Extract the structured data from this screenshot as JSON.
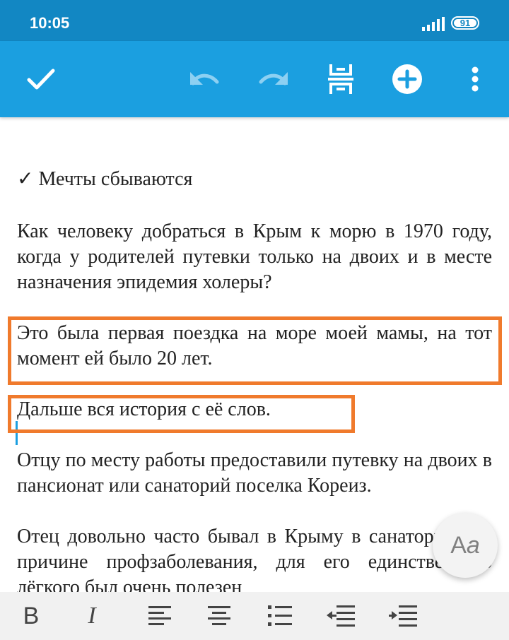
{
  "status_bar": {
    "time": "10:05",
    "battery": "91"
  },
  "toolbar": {
    "icons": [
      "check-icon",
      "undo-icon",
      "redo-icon",
      "page-layout-icon",
      "add-circle-icon",
      "more-vert-icon"
    ],
    "color": "#1b9fe0"
  },
  "document": {
    "title": "✓ Мечты сбываются",
    "paragraphs": [
      "Как человеку добраться в Крым к морю в 1970 году, когда у родителей путевки только на двоих и в месте назначения эпидемия холеры?",
      "Это была первая поездка на море моей мамы, на тот момент ей было 20 лет.",
      "Дальше вся история с её слов.",
      "Отцу по месту работы предоставили путевку на двоих в пансионат или санаторий поселка Кореиз.",
      "Отец довольно часто бывал в Крыму в санаториях по причине профзаболевания, для его единственного лёгкого был очень полезен"
    ]
  },
  "highlight_color": "#f07a2c",
  "font_fab": {
    "label_a": "A",
    "label_a_italic": "a"
  },
  "format_bar": {
    "bold_label": "B",
    "italic_label": "I",
    "icons": [
      "align-left-icon",
      "align-center-icon",
      "bullet-list-icon",
      "outdent-icon",
      "indent-icon"
    ]
  }
}
